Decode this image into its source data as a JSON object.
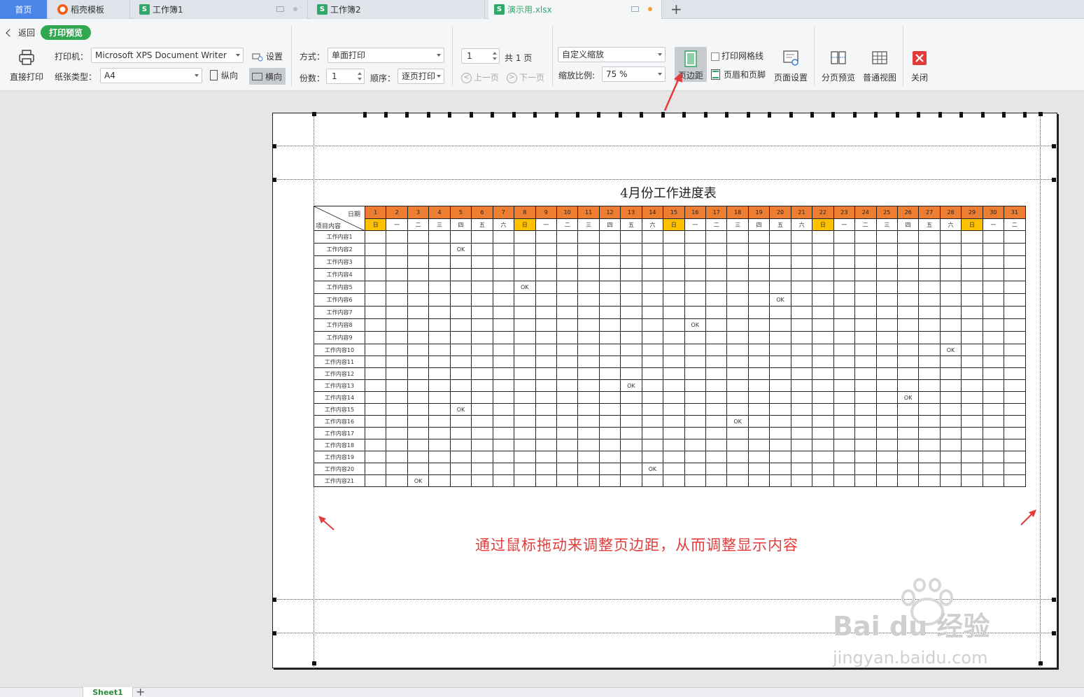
{
  "tabs": [
    {
      "label": "首页",
      "type": "home"
    },
    {
      "label": "稻壳模板",
      "icon": "docer-icon"
    },
    {
      "label": "工作簿1",
      "icon": "sheet-icon"
    },
    {
      "label": "工作簿2",
      "icon": "sheet-icon"
    },
    {
      "label": "演示用.xlsx",
      "icon": "sheet-icon",
      "active": true
    }
  ],
  "new_tab_label": "+",
  "toolbar": {
    "back_label": "返回",
    "mode_label": "打印预览",
    "direct_print_label": "直接打印",
    "printer_label": "打印机：",
    "printer_value": "Microsoft XPS Document Writer",
    "settings_label": "设置",
    "paper_label": "纸张类型：",
    "paper_value": "A4",
    "portrait_label": "纵向",
    "landscape_label": "横向",
    "method_label": "方式：",
    "method_value": "单面打印",
    "copies_label": "份数：",
    "copies_value": "1",
    "order_label": "顺序：",
    "order_value": "逐页打印",
    "page_input": "1",
    "total_pages": "共 1 页",
    "prev_label": "上一页",
    "next_label": "下一页",
    "zoom_mode": "自定义缩放",
    "scale_label": "缩放比例:",
    "scale_value": "75 %",
    "margin_label": "页边距",
    "gridlines_label": "打印网格线",
    "header_footer_label": "页眉和页脚",
    "page_setup_label": "页面设置",
    "page_break_label": "分页预览",
    "normal_view_label": "普通视图",
    "close_label": "关闭"
  },
  "sheet": {
    "title": "4月份工作进度表",
    "corner_top": "日期",
    "corner_bottom": "项目内容",
    "days": [
      "1",
      "2",
      "3",
      "4",
      "5",
      "6",
      "7",
      "8",
      "9",
      "10",
      "11",
      "12",
      "13",
      "14",
      "15",
      "16",
      "17",
      "18",
      "19",
      "20",
      "21",
      "22",
      "23",
      "24",
      "25",
      "26",
      "27",
      "28",
      "29",
      "30",
      "31"
    ],
    "weekdays": [
      "日",
      "一",
      "二",
      "三",
      "四",
      "五",
      "六",
      "日",
      "一",
      "二",
      "三",
      "四",
      "五",
      "六",
      "日",
      "一",
      "二",
      "三",
      "四",
      "五",
      "六",
      "日",
      "一",
      "二",
      "三",
      "四",
      "五",
      "六",
      "日",
      "一",
      "二"
    ],
    "rows": [
      "工作内容1",
      "工作内容2",
      "工作内容3",
      "工作内容4",
      "工作内容5",
      "工作内容6",
      "工作内容7",
      "工作内容8",
      "工作内容9",
      "工作内容10",
      "工作内容11",
      "工作内容12",
      "工作内容13",
      "工作内容14",
      "工作内容15",
      "工作内容16",
      "工作内容17",
      "工作内容18",
      "工作内容19",
      "工作内容20",
      "工作内容21"
    ],
    "ok_text": "OK",
    "ok_marks": [
      {
        "row": 2,
        "day": 5
      },
      {
        "row": 5,
        "day": 8
      },
      {
        "row": 6,
        "day": 20
      },
      {
        "row": 8,
        "day": 16
      },
      {
        "row": 10,
        "day": 28
      },
      {
        "row": 13,
        "day": 13
      },
      {
        "row": 14,
        "day": 26
      },
      {
        "row": 15,
        "day": 5
      },
      {
        "row": 16,
        "day": 18
      },
      {
        "row": 20,
        "day": 14
      },
      {
        "row": 21,
        "day": 3
      }
    ]
  },
  "caption": "通过鼠标拖动来调整页边距，从而调整显示内容",
  "watermark": {
    "brand": "Bai du 经验",
    "url": "jingyan.baidu.com"
  },
  "sheet_tab": "Sheet1",
  "colors": {
    "header": "#ed7d31",
    "sunday": "#ffc000",
    "caption": "#e53b3b",
    "accent": "#2fa84f",
    "home_tab": "#4a86e8"
  }
}
